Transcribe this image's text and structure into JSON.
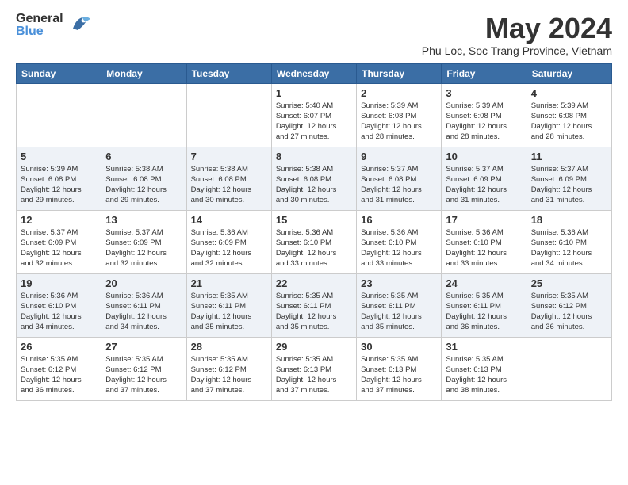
{
  "header": {
    "logo_line1": "General",
    "logo_line2": "Blue",
    "month_title": "May 2024",
    "location": "Phu Loc, Soc Trang Province, Vietnam"
  },
  "calendar": {
    "days_of_week": [
      "Sunday",
      "Monday",
      "Tuesday",
      "Wednesday",
      "Thursday",
      "Friday",
      "Saturday"
    ],
    "weeks": [
      [
        {
          "day": "",
          "info": ""
        },
        {
          "day": "",
          "info": ""
        },
        {
          "day": "",
          "info": ""
        },
        {
          "day": "1",
          "info": "Sunrise: 5:40 AM\nSunset: 6:07 PM\nDaylight: 12 hours\nand 27 minutes."
        },
        {
          "day": "2",
          "info": "Sunrise: 5:39 AM\nSunset: 6:08 PM\nDaylight: 12 hours\nand 28 minutes."
        },
        {
          "day": "3",
          "info": "Sunrise: 5:39 AM\nSunset: 6:08 PM\nDaylight: 12 hours\nand 28 minutes."
        },
        {
          "day": "4",
          "info": "Sunrise: 5:39 AM\nSunset: 6:08 PM\nDaylight: 12 hours\nand 28 minutes."
        }
      ],
      [
        {
          "day": "5",
          "info": "Sunrise: 5:39 AM\nSunset: 6:08 PM\nDaylight: 12 hours\nand 29 minutes."
        },
        {
          "day": "6",
          "info": "Sunrise: 5:38 AM\nSunset: 6:08 PM\nDaylight: 12 hours\nand 29 minutes."
        },
        {
          "day": "7",
          "info": "Sunrise: 5:38 AM\nSunset: 6:08 PM\nDaylight: 12 hours\nand 30 minutes."
        },
        {
          "day": "8",
          "info": "Sunrise: 5:38 AM\nSunset: 6:08 PM\nDaylight: 12 hours\nand 30 minutes."
        },
        {
          "day": "9",
          "info": "Sunrise: 5:37 AM\nSunset: 6:08 PM\nDaylight: 12 hours\nand 31 minutes."
        },
        {
          "day": "10",
          "info": "Sunrise: 5:37 AM\nSunset: 6:09 PM\nDaylight: 12 hours\nand 31 minutes."
        },
        {
          "day": "11",
          "info": "Sunrise: 5:37 AM\nSunset: 6:09 PM\nDaylight: 12 hours\nand 31 minutes."
        }
      ],
      [
        {
          "day": "12",
          "info": "Sunrise: 5:37 AM\nSunset: 6:09 PM\nDaylight: 12 hours\nand 32 minutes."
        },
        {
          "day": "13",
          "info": "Sunrise: 5:37 AM\nSunset: 6:09 PM\nDaylight: 12 hours\nand 32 minutes."
        },
        {
          "day": "14",
          "info": "Sunrise: 5:36 AM\nSunset: 6:09 PM\nDaylight: 12 hours\nand 32 minutes."
        },
        {
          "day": "15",
          "info": "Sunrise: 5:36 AM\nSunset: 6:10 PM\nDaylight: 12 hours\nand 33 minutes."
        },
        {
          "day": "16",
          "info": "Sunrise: 5:36 AM\nSunset: 6:10 PM\nDaylight: 12 hours\nand 33 minutes."
        },
        {
          "day": "17",
          "info": "Sunrise: 5:36 AM\nSunset: 6:10 PM\nDaylight: 12 hours\nand 33 minutes."
        },
        {
          "day": "18",
          "info": "Sunrise: 5:36 AM\nSunset: 6:10 PM\nDaylight: 12 hours\nand 34 minutes."
        }
      ],
      [
        {
          "day": "19",
          "info": "Sunrise: 5:36 AM\nSunset: 6:10 PM\nDaylight: 12 hours\nand 34 minutes."
        },
        {
          "day": "20",
          "info": "Sunrise: 5:36 AM\nSunset: 6:11 PM\nDaylight: 12 hours\nand 34 minutes."
        },
        {
          "day": "21",
          "info": "Sunrise: 5:35 AM\nSunset: 6:11 PM\nDaylight: 12 hours\nand 35 minutes."
        },
        {
          "day": "22",
          "info": "Sunrise: 5:35 AM\nSunset: 6:11 PM\nDaylight: 12 hours\nand 35 minutes."
        },
        {
          "day": "23",
          "info": "Sunrise: 5:35 AM\nSunset: 6:11 PM\nDaylight: 12 hours\nand 35 minutes."
        },
        {
          "day": "24",
          "info": "Sunrise: 5:35 AM\nSunset: 6:11 PM\nDaylight: 12 hours\nand 36 minutes."
        },
        {
          "day": "25",
          "info": "Sunrise: 5:35 AM\nSunset: 6:12 PM\nDaylight: 12 hours\nand 36 minutes."
        }
      ],
      [
        {
          "day": "26",
          "info": "Sunrise: 5:35 AM\nSunset: 6:12 PM\nDaylight: 12 hours\nand 36 minutes."
        },
        {
          "day": "27",
          "info": "Sunrise: 5:35 AM\nSunset: 6:12 PM\nDaylight: 12 hours\nand 37 minutes."
        },
        {
          "day": "28",
          "info": "Sunrise: 5:35 AM\nSunset: 6:12 PM\nDaylight: 12 hours\nand 37 minutes."
        },
        {
          "day": "29",
          "info": "Sunrise: 5:35 AM\nSunset: 6:13 PM\nDaylight: 12 hours\nand 37 minutes."
        },
        {
          "day": "30",
          "info": "Sunrise: 5:35 AM\nSunset: 6:13 PM\nDaylight: 12 hours\nand 37 minutes."
        },
        {
          "day": "31",
          "info": "Sunrise: 5:35 AM\nSunset: 6:13 PM\nDaylight: 12 hours\nand 38 minutes."
        },
        {
          "day": "",
          "info": ""
        }
      ]
    ]
  }
}
